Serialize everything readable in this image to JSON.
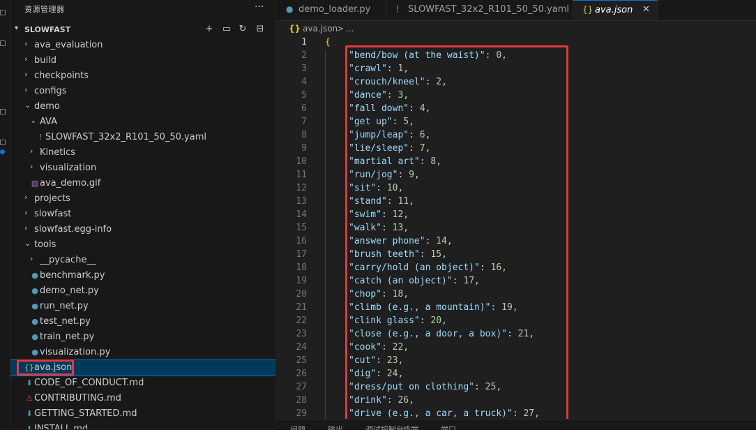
{
  "explorer": {
    "title": "资源管理器",
    "more_label": "···",
    "project": "SLOWFAST",
    "toolbar": [
      {
        "name": "new-file-icon",
        "glyph": "🗋"
      },
      {
        "name": "new-folder-icon",
        "glyph": "🗀"
      },
      {
        "name": "refresh-icon",
        "glyph": "↻"
      },
      {
        "name": "collapse-all-icon",
        "glyph": "⊟"
      }
    ],
    "items": [
      {
        "label": "ava_evaluation",
        "type": "folder",
        "depth": 0,
        "expanded": false
      },
      {
        "label": "build",
        "type": "folder",
        "depth": 0,
        "expanded": false
      },
      {
        "label": "checkpoints",
        "type": "folder",
        "depth": 0,
        "expanded": false
      },
      {
        "label": "configs",
        "type": "folder",
        "depth": 0,
        "expanded": false
      },
      {
        "label": "demo",
        "type": "folder",
        "depth": 0,
        "expanded": true
      },
      {
        "label": "AVA",
        "type": "folder",
        "depth": 1,
        "expanded": true
      },
      {
        "label": "SLOWFAST_32x2_R101_50_50.yaml",
        "type": "yaml",
        "depth": 2
      },
      {
        "label": "Kinetics",
        "type": "folder",
        "depth": 1,
        "expanded": false
      },
      {
        "label": "visualization",
        "type": "folder",
        "depth": 1,
        "expanded": false
      },
      {
        "label": "ava_demo.gif",
        "type": "gif",
        "depth": 1
      },
      {
        "label": "projects",
        "type": "folder",
        "depth": 0,
        "expanded": false
      },
      {
        "label": "slowfast",
        "type": "folder",
        "depth": 0,
        "expanded": false
      },
      {
        "label": "slowfast.egg-info",
        "type": "folder",
        "depth": 0,
        "expanded": false
      },
      {
        "label": "tools",
        "type": "folder",
        "depth": 0,
        "expanded": true
      },
      {
        "label": "__pycache__",
        "type": "folder",
        "depth": 1,
        "expanded": false
      },
      {
        "label": "benchmark.py",
        "type": "python",
        "depth": 1
      },
      {
        "label": "demo_net.py",
        "type": "python",
        "depth": 1
      },
      {
        "label": "run_net.py",
        "type": "python",
        "depth": 1
      },
      {
        "label": "test_net.py",
        "type": "python",
        "depth": 1
      },
      {
        "label": "train_net.py",
        "type": "python",
        "depth": 1
      },
      {
        "label": "visualization.py",
        "type": "python",
        "depth": 1
      },
      {
        "label": "ava.json",
        "type": "json",
        "depth": 0,
        "selected": true
      },
      {
        "label": "CODE_OF_CONDUCT.md",
        "type": "md",
        "depth": 0
      },
      {
        "label": "CONTRIBUTING.md",
        "type": "md-red",
        "depth": 0
      },
      {
        "label": "GETTING_STARTED.md",
        "type": "md",
        "depth": 0
      },
      {
        "label": "INSTALL.md",
        "type": "md",
        "depth": 0
      }
    ]
  },
  "tabs": [
    {
      "label": "demo_loader.py",
      "type": "python",
      "active": false
    },
    {
      "label": "SLOWFAST_32x2_R101_50_50.yaml",
      "type": "yaml",
      "active": false
    },
    {
      "label": "ava.json",
      "type": "json",
      "active": true
    }
  ],
  "icons": {
    "python": "⬢",
    "yaml": "!",
    "json": "{}",
    "gif": "▨",
    "md": "⬇",
    "md_red": "⚠",
    "close": "✕",
    "chevron_right": "›",
    "chevron_down": "⌄"
  },
  "colors": {
    "python": "#519aba",
    "yaml": "#b180d7",
    "json": "#cbcb41",
    "gif": "#a074c4",
    "md": "#519aba",
    "md_red": "#e03a3a",
    "highlight": "#e03a3a",
    "accent": "#0078d4"
  },
  "breadcrumb": {
    "file": "ava.json",
    "sep": ">",
    "rest": "..."
  },
  "editor": {
    "open_brace": "{",
    "lines": [
      {
        "key": "\"bend/bow (at the waist)\"",
        "value": "0"
      },
      {
        "key": "\"crawl\"",
        "value": "1"
      },
      {
        "key": "\"crouch/kneel\"",
        "value": "2"
      },
      {
        "key": "\"dance\"",
        "value": "3"
      },
      {
        "key": "\"fall down\"",
        "value": "4"
      },
      {
        "key": "\"get up\"",
        "value": "5"
      },
      {
        "key": "\"jump/leap\"",
        "value": "6"
      },
      {
        "key": "\"lie/sleep\"",
        "value": "7"
      },
      {
        "key": "\"martial art\"",
        "value": "8"
      },
      {
        "key": "\"run/jog\"",
        "value": "9"
      },
      {
        "key": "\"sit\"",
        "value": "10"
      },
      {
        "key": "\"stand\"",
        "value": "11"
      },
      {
        "key": "\"swim\"",
        "value": "12"
      },
      {
        "key": "\"walk\"",
        "value": "13"
      },
      {
        "key": "\"answer phone\"",
        "value": "14"
      },
      {
        "key": "\"brush teeth\"",
        "value": "15"
      },
      {
        "key": "\"carry/hold (an object)\"",
        "value": "16"
      },
      {
        "key": "\"catch (an object)\"",
        "value": "17"
      },
      {
        "key": "\"chop\"",
        "value": "18"
      },
      {
        "key": "\"climb (e.g., a mountain)\"",
        "value": "19"
      },
      {
        "key": "\"clink glass\"",
        "value": "20"
      },
      {
        "key": "\"close (e.g., a door, a box)\"",
        "value": "21"
      },
      {
        "key": "\"cook\"",
        "value": "22"
      },
      {
        "key": "\"cut\"",
        "value": "23"
      },
      {
        "key": "\"dig\"",
        "value": "24"
      },
      {
        "key": "\"dress/put on clothing\"",
        "value": "25"
      },
      {
        "key": "\"drink\"",
        "value": "26"
      },
      {
        "key": "\"drive (e.g., a car, a truck)\"",
        "value": "27"
      }
    ]
  },
  "panel": {
    "tabs": [
      "问题",
      "输出",
      "调试控制台",
      "终端",
      "端口"
    ]
  }
}
